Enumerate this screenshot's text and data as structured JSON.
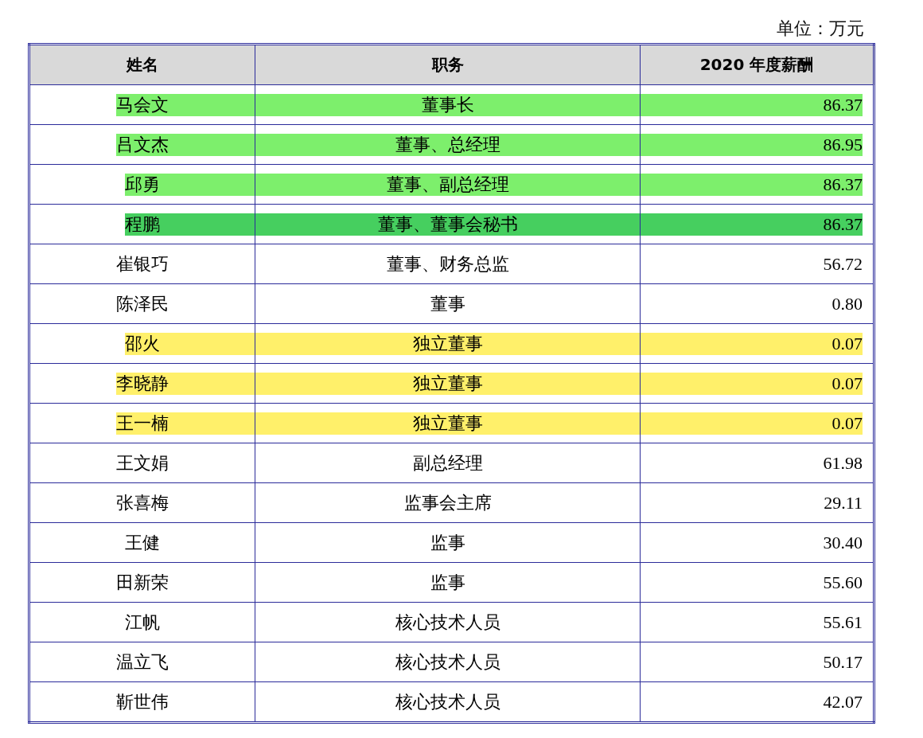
{
  "unit_note": "单位：万元",
  "table": {
    "columns": [
      "姓名",
      "职务",
      "2020 年度薪酬"
    ],
    "rows": [
      {
        "name": "马会文",
        "position": "董事长",
        "salary": "86.37",
        "color": "#7def6c"
      },
      {
        "name": "吕文杰",
        "position": "董事、总经理",
        "salary": "86.95",
        "color": "#7def6c"
      },
      {
        "name": "邱勇",
        "position": "董事、副总经理",
        "salary": "86.37",
        "color": "#7def6c"
      },
      {
        "name": "程鹏",
        "position": "董事、董事会秘书",
        "salary": "86.37",
        "color": "#46cf5f"
      },
      {
        "name": "崔银巧",
        "position": "董事、财务总监",
        "salary": "56.72"
      },
      {
        "name": "陈泽民",
        "position": "董事",
        "salary": "0.80"
      },
      {
        "name": "邵火",
        "position": "独立董事",
        "salary": "0.07",
        "color": "#fff06a"
      },
      {
        "name": "李晓静",
        "position": "独立董事",
        "salary": "0.07",
        "color": "#fff06a"
      },
      {
        "name": "王一楠",
        "position": "独立董事",
        "salary": "0.07",
        "color": "#fff06a"
      },
      {
        "name": "王文娟",
        "position": "副总经理",
        "salary": "61.98"
      },
      {
        "name": "张喜梅",
        "position": "监事会主席",
        "salary": "29.11"
      },
      {
        "name": "王健",
        "position": "监事",
        "salary": "30.40"
      },
      {
        "name": "田新荣",
        "position": "监事",
        "salary": "55.60"
      },
      {
        "name": "江帆",
        "position": "核心技术人员",
        "salary": "55.61"
      },
      {
        "name": "温立飞",
        "position": "核心技术人员",
        "salary": "50.17"
      },
      {
        "name": "靳世伟",
        "position": "核心技术人员",
        "salary": "42.07"
      }
    ]
  }
}
